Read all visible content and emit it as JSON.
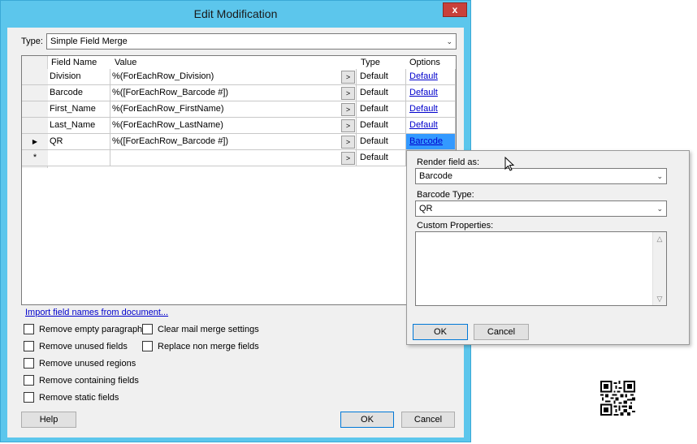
{
  "window": {
    "title": "Edit Modification",
    "close_glyph": "x"
  },
  "type_field": {
    "label": "Type:",
    "value": "Simple Field Merge"
  },
  "grid": {
    "columns": [
      "Field Name",
      "Value",
      "Type",
      "Options"
    ],
    "expand_button": ">",
    "rows": [
      {
        "marker": "",
        "field_name": "Division",
        "value": "%(ForEachRow_Division)",
        "type": "Default",
        "option": "Default"
      },
      {
        "marker": "",
        "field_name": "Barcode",
        "value": "%([ForEachRow_Barcode #])",
        "type": "Default",
        "option": "Default"
      },
      {
        "marker": "",
        "field_name": "First_Name",
        "value": "%(ForEachRow_FirstName)",
        "type": "Default",
        "option": "Default"
      },
      {
        "marker": "",
        "field_name": "Last_Name",
        "value": "%(ForEachRow_LastName)",
        "type": "Default",
        "option": "Default"
      },
      {
        "marker": "▶",
        "field_name": "QR",
        "value": "%([ForEachRow_Barcode #])",
        "type": "Default",
        "option": "Barcode"
      },
      {
        "marker": "*",
        "field_name": "",
        "value": "",
        "type": "Default",
        "option": ""
      }
    ]
  },
  "import_link": "Import field names from document...",
  "checkboxes": {
    "remove_empty_paragraphs": "Remove empty paragraphs",
    "clear_mail_merge": "Clear mail merge settings",
    "remove_unused_fields": "Remove unused fields",
    "replace_non_merge": "Replace non merge fields",
    "remove_unused_regions": "Remove unused regions",
    "remove_containing_fields": "Remove containing fields",
    "remove_static_fields": "Remove static fields"
  },
  "buttons": {
    "help": "Help",
    "ok": "OK",
    "cancel": "Cancel"
  },
  "popup": {
    "render_label": "Render field as:",
    "render_value": "Barcode",
    "barcode_type_label": "Barcode Type:",
    "barcode_type_value": "QR",
    "custom_props_label": "Custom Properties:",
    "ok": "OK",
    "cancel": "Cancel"
  },
  "colors": {
    "title_bar": "#5cc6ec",
    "link": "#0000cc",
    "selection": "#3399ff",
    "close": "#c9403a"
  }
}
